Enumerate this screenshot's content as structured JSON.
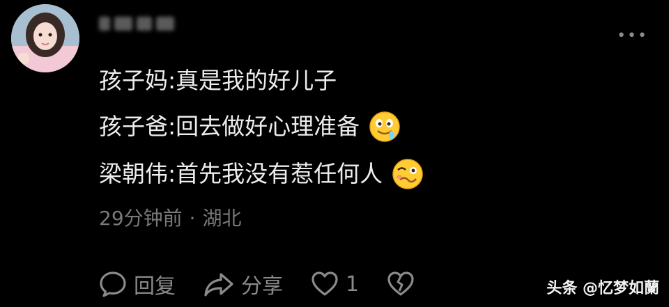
{
  "user": {
    "name_obscured": true
  },
  "comment": {
    "lines": [
      {
        "text": "孩子妈:真是我的好儿子",
        "emoji": ""
      },
      {
        "text": "孩子爸:回去做好心理准备",
        "emoji": "drooling-face"
      },
      {
        "text": "梁朝伟:首先我没有惹任何人",
        "emoji": "woozy-face"
      }
    ],
    "time": "29分钟前",
    "separator": "·",
    "location": "湖北"
  },
  "actions": {
    "reply_label": "回复",
    "share_label": "分享",
    "like_count": "1"
  },
  "watermark": "头条 @忆梦如蘭",
  "icons": {
    "more": "more-horizontal-icon",
    "reply": "comment-bubble-icon",
    "share": "share-arrow-icon",
    "like": "heart-outline-icon",
    "dislike": "broken-heart-icon"
  },
  "colors": {
    "background": "#000000",
    "text": "#ededed",
    "muted": "#7a7a7a"
  }
}
